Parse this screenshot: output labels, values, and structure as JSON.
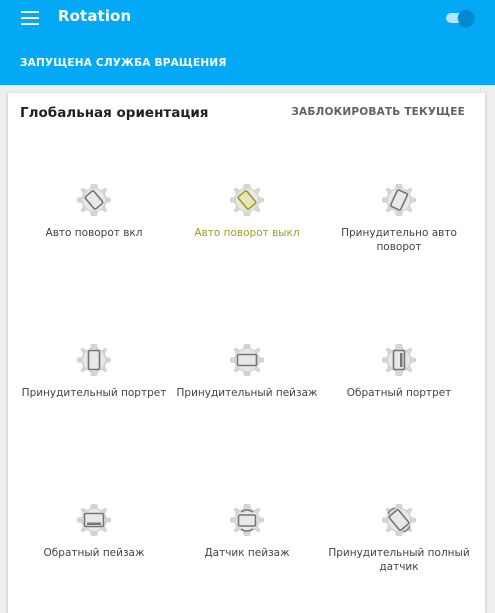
{
  "app_bar": {
    "title": "Rotation",
    "menu_icon": "hamburger-menu-icon",
    "service_enabled": true,
    "status_text": "ЗАПУЩЕНА СЛУЖБА ВРАЩЕНИЯ"
  },
  "colors": {
    "primary": "#03a9f4",
    "toggle_thumb": "#0288d1",
    "toggle_track": "#b3e5fc",
    "active_mode": "#9e9d24",
    "icon_gear": "#cfcfcf",
    "icon_device": "#757575"
  },
  "orientation": {
    "title": "Глобальная ориентация",
    "lock_current_label": "ЗАБЛОКИРОВАТЬ ТЕКУЩЕЕ",
    "modes": [
      {
        "label": "Авто поворот вкл",
        "icon": "auto-rotate-on-icon",
        "active": false
      },
      {
        "label": "Авто поворот выкл",
        "icon": "auto-rotate-off-icon",
        "active": true
      },
      {
        "label": "Принудительно авто поворот",
        "icon": "force-auto-rotate-icon",
        "active": false
      },
      {
        "label": "Принудительный портрет",
        "icon": "force-portrait-icon",
        "active": false
      },
      {
        "label": "Принудительный пейзаж",
        "icon": "force-landscape-icon",
        "active": false
      },
      {
        "label": "Обратный портрет",
        "icon": "reverse-portrait-icon",
        "active": false
      },
      {
        "label": "Обратный пейзаж",
        "icon": "reverse-landscape-icon",
        "active": false
      },
      {
        "label": "Датчик пейзаж",
        "icon": "sensor-landscape-icon",
        "active": false
      },
      {
        "label": "Принудительный полный датчик",
        "icon": "force-full-sensor-icon",
        "active": false
      }
    ]
  }
}
